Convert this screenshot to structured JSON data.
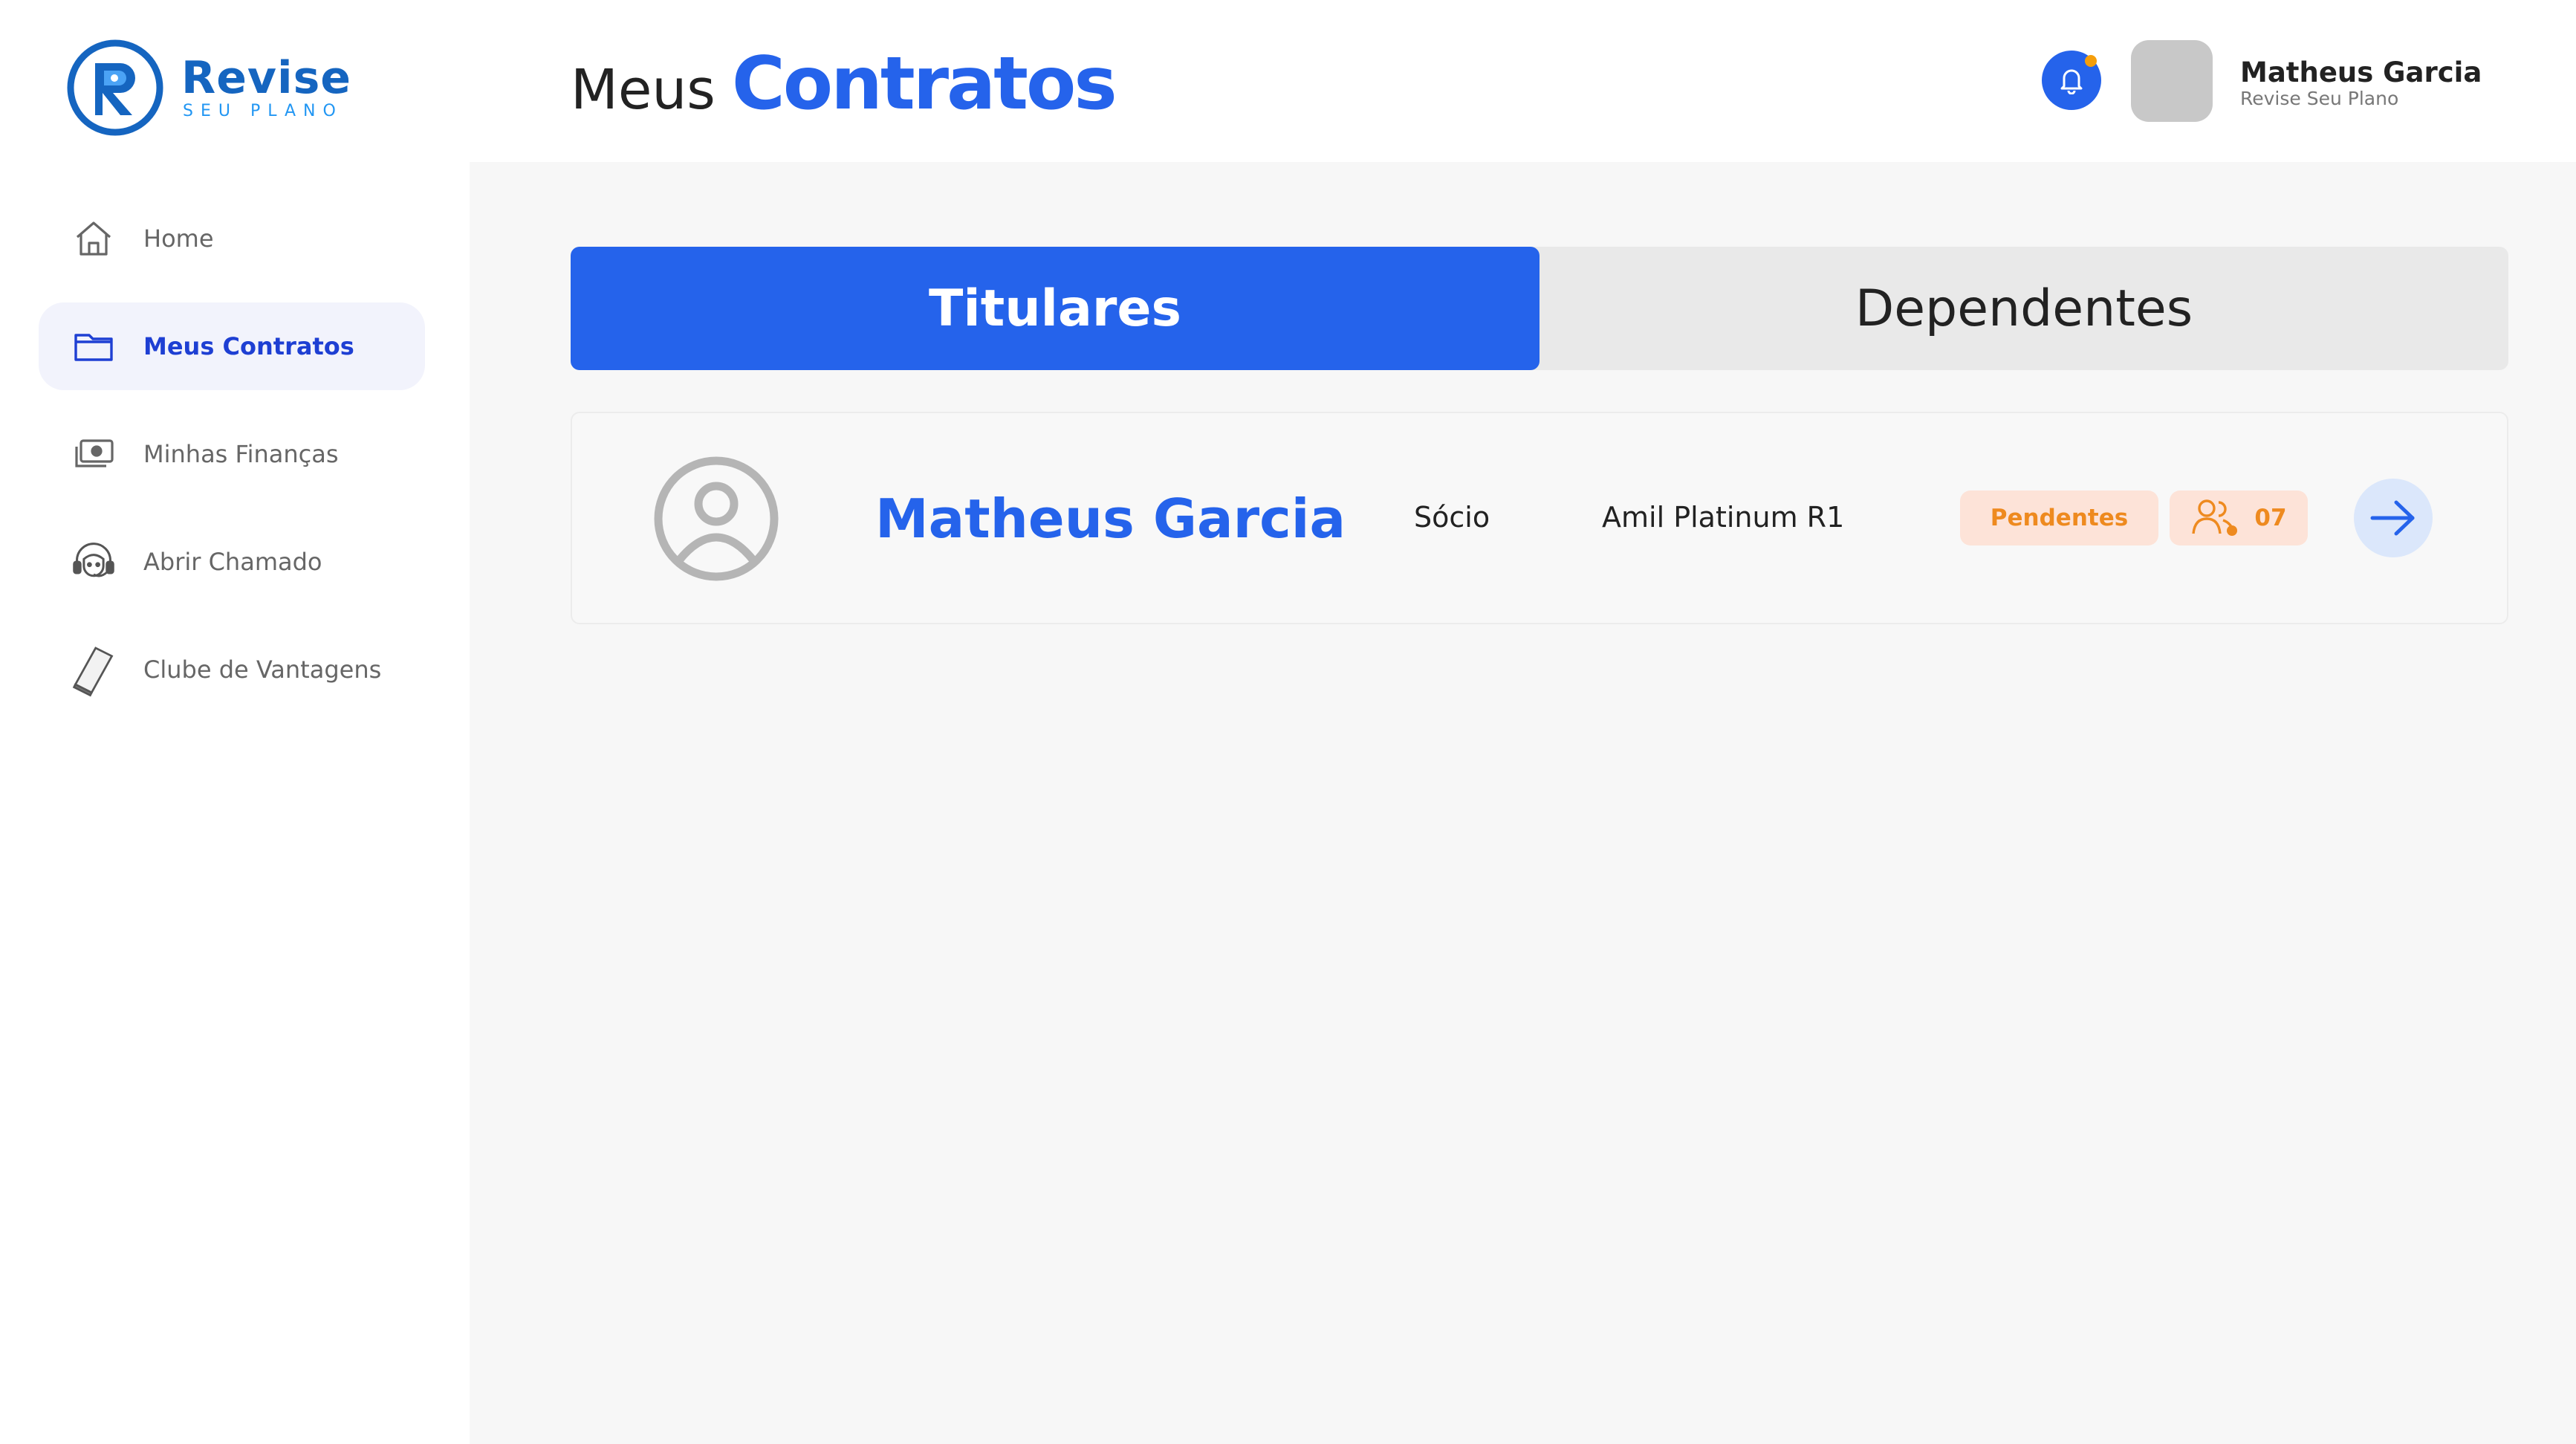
{
  "brand": {
    "name": "Revise",
    "tagline": "SEU PLANO",
    "primary_color": "#2563eb",
    "accent_color": "#f59e0b"
  },
  "sidebar": {
    "items": [
      {
        "label": "Home",
        "icon": "home-icon",
        "active": false
      },
      {
        "label": "Meus Contratos",
        "icon": "folder-icon",
        "active": true
      },
      {
        "label": "Minhas Finanças",
        "icon": "money-icon",
        "active": false
      },
      {
        "label": "Abrir Chamado",
        "icon": "headset-icon",
        "active": false
      },
      {
        "label": "Clube de Vantagens",
        "icon": "card-icon",
        "active": false
      }
    ]
  },
  "header": {
    "title_light": "Meus",
    "title_bold": "Contratos",
    "notification_icon": "bell-icon",
    "user": {
      "name": "Matheus Garcia",
      "subtitle": "Revise Seu Plano"
    }
  },
  "tabs": [
    {
      "label": "Titulares",
      "active": true
    },
    {
      "label": "Dependentes",
      "active": false
    }
  ],
  "contracts": [
    {
      "name": "Matheus Garcia",
      "role": "Sócio",
      "plan": "Amil Platinum R1",
      "status": "Pendentes",
      "dependents_count": "07",
      "status_color": "#ee8a1f",
      "status_bg": "#fde3d8"
    }
  ]
}
